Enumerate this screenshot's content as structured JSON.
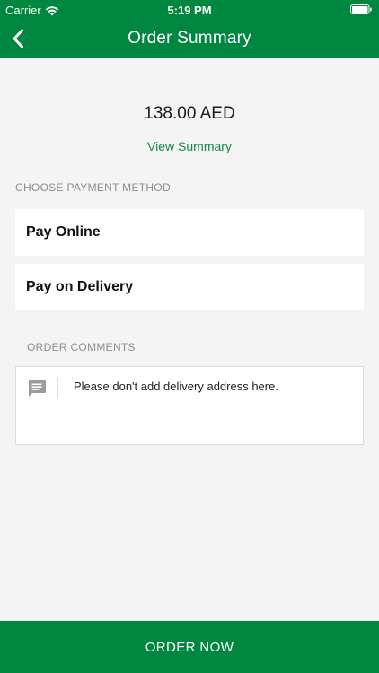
{
  "status_bar": {
    "carrier": "Carrier",
    "time": "5:19 PM",
    "wifi_icon": "wifi-icon",
    "battery_icon": "battery-icon"
  },
  "nav": {
    "back_icon": "chevron-left-icon",
    "title": "Order Summary"
  },
  "summary": {
    "amount": "138.00 AED",
    "view_summary_link": "View Summary"
  },
  "payment": {
    "section_label": "CHOOSE PAYMENT METHOD",
    "options": [
      {
        "label": "Pay Online"
      },
      {
        "label": "Pay on Delivery"
      }
    ]
  },
  "comments": {
    "section_label": "ORDER COMMENTS",
    "icon": "comment-icon",
    "placeholder": "Please don't add delivery address here."
  },
  "footer": {
    "order_button_label": "ORDER NOW"
  },
  "colors": {
    "brand_green": "#00873f",
    "link_green": "#138a44",
    "background": "#f4f4f4",
    "section_label": "#8d8d8d"
  }
}
